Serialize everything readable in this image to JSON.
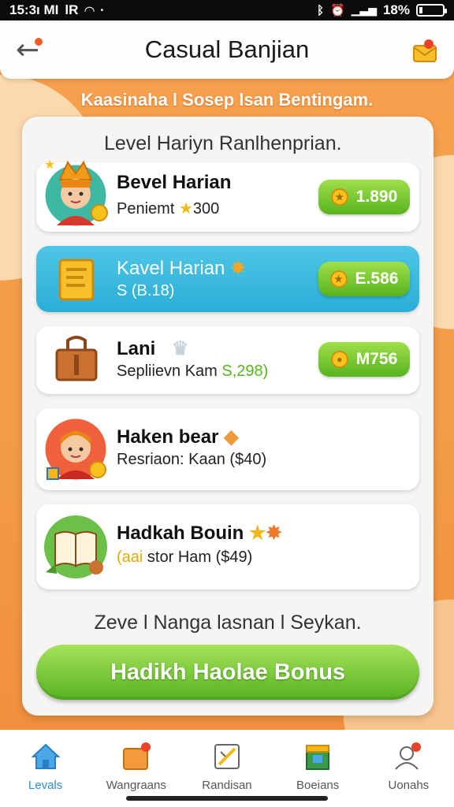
{
  "status_bar": {
    "time": "15:3ı MI",
    "carrier": "lR",
    "battery_pct": "18%"
  },
  "header": {
    "title": "Casual Banjian"
  },
  "subtitle": "Kaasinaha l Sosep lsan Bentingam.",
  "panel": {
    "heading": "Level Hariyn Ranlhenprian.",
    "cards": [
      {
        "title": "Bevel Harian",
        "sub_prefix": "Peniemt",
        "sub_value": "300",
        "reward": "1.890"
      },
      {
        "title": "Kavel Harian",
        "sub_prefix": "S (B.18)",
        "sub_value": "",
        "reward": "E.586"
      },
      {
        "title": "Lani",
        "sub_prefix": "Sepliievn Kam ",
        "sub_value": "S,298)",
        "reward": "M756"
      },
      {
        "title": "Haken bear",
        "sub_prefix": "Resriaon: Kaan ($40)",
        "sub_value": ""
      },
      {
        "title": "Hadkah Bouin",
        "sub_prefix": "(aai",
        "sub_value": " stor Ham ($49)"
      }
    ],
    "footer_text": "Zeve l Nanga lasnan l Seykan.",
    "bonus_button": "Hadikh Haolae Bonus"
  },
  "nav": [
    {
      "label": "Levals",
      "icon": "home-icon"
    },
    {
      "label": "Wangraans",
      "icon": "calendar-icon"
    },
    {
      "label": "Randisan",
      "icon": "map-icon"
    },
    {
      "label": "Boeians",
      "icon": "box-icon"
    },
    {
      "label": "Uonahs",
      "icon": "user-icon"
    }
  ],
  "colors": {
    "accent_green": "#58b41f",
    "highlight_blue": "#2aaed7",
    "brand_orange": "#f39a45"
  }
}
